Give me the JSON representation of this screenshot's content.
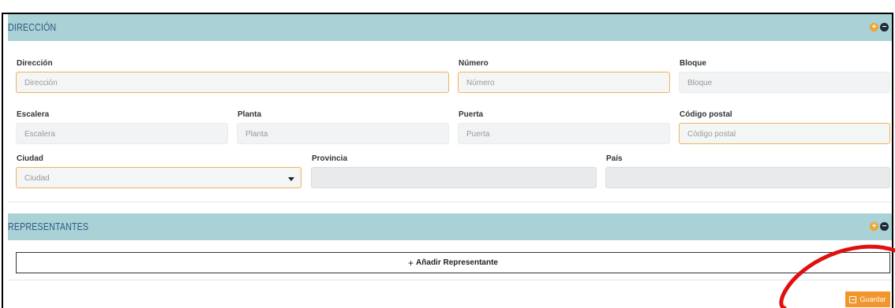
{
  "direccion_section": {
    "title": "DIRECCIÓN",
    "fields": {
      "direccion": {
        "label": "Dirección",
        "placeholder": "Dirección"
      },
      "numero": {
        "label": "Número",
        "placeholder": "Número"
      },
      "bloque": {
        "label": "Bloque",
        "placeholder": "Bloque"
      },
      "escalera": {
        "label": "Escalera",
        "placeholder": "Escalera"
      },
      "planta": {
        "label": "Planta",
        "placeholder": "Planta"
      },
      "puerta": {
        "label": "Puerta",
        "placeholder": "Puerta"
      },
      "codigo_postal": {
        "label": "Código postal",
        "placeholder": "Código postal"
      },
      "ciudad": {
        "label": "Ciudad",
        "placeholder": "Ciudad"
      },
      "provincia": {
        "label": "Provincia",
        "value": ""
      },
      "pais": {
        "label": "País",
        "value": ""
      }
    }
  },
  "representantes_section": {
    "title": "REPRESENTANTES",
    "add_plus": "+",
    "add_label": "Añadir Representante"
  },
  "actions": {
    "save_label": "Guardar"
  },
  "colors": {
    "header_bg": "#a9d1d6",
    "header_text": "#2e5a82",
    "accent_orange": "#f0962c",
    "annotation_red": "#e01010"
  },
  "icons": [
    "expand-icon",
    "collapse-icon",
    "save-icon",
    "caret-down-icon"
  ]
}
